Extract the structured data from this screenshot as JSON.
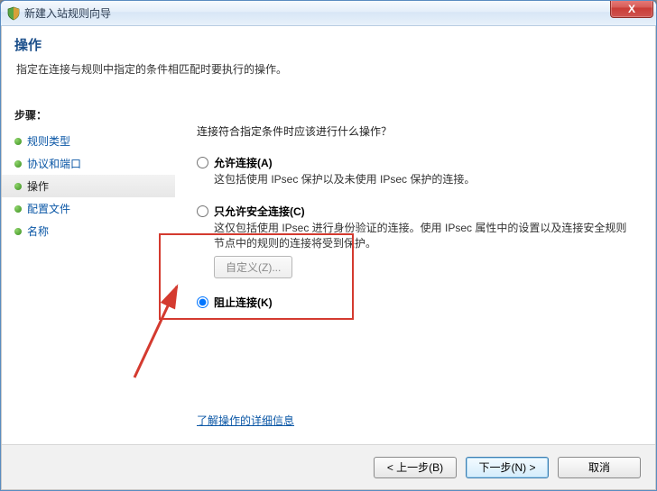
{
  "window": {
    "title": "新建入站规则向导",
    "close_x": "X"
  },
  "header": {
    "title": "操作",
    "subtitle": "指定在连接与规则中指定的条件相匹配时要执行的操作。"
  },
  "sidebar": {
    "title": "步骤：",
    "items": [
      {
        "label": "规则类型",
        "active": false
      },
      {
        "label": "协议和端口",
        "active": false
      },
      {
        "label": "操作",
        "active": true
      },
      {
        "label": "配置文件",
        "active": false
      },
      {
        "label": "名称",
        "active": false
      }
    ]
  },
  "main": {
    "question": "连接符合指定条件时应该进行什么操作？",
    "options": {
      "allow": {
        "title": "允许连接(A)",
        "desc": "这包括使用 IPsec 保护以及未使用 IPsec 保护的连接。"
      },
      "secure": {
        "title": "只允许安全连接(C)",
        "desc": "这仅包括使用 IPsec 进行身份验证的连接。使用 IPsec 属性中的设置以及连接安全规则节点中的规则的连接将受到保护。",
        "custom_button": "自定义(Z)..."
      },
      "block": {
        "title": "阻止连接(K)"
      }
    },
    "selected": "block",
    "learn_link": "了解操作的详细信息"
  },
  "footer": {
    "back": "< 上一步(B)",
    "next": "下一步(N) >",
    "cancel": "取消"
  }
}
